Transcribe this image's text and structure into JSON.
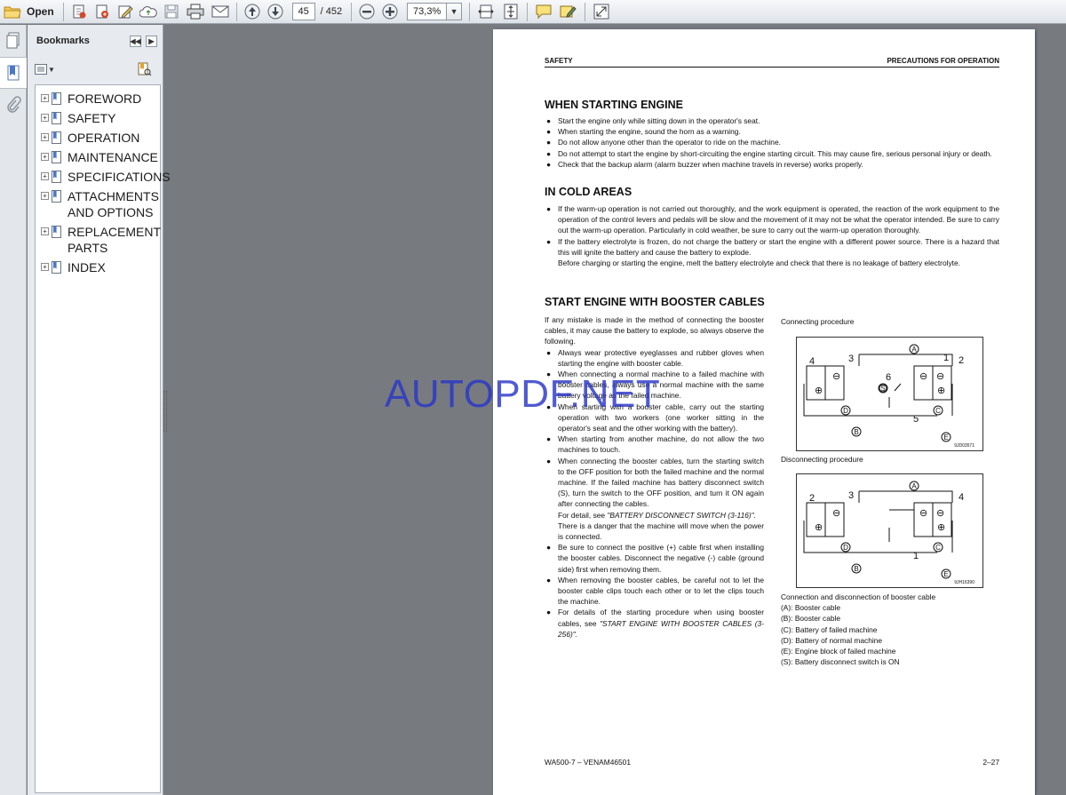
{
  "toolbar": {
    "open_label": "Open",
    "current_page": "45",
    "total_pages": "/ 452",
    "zoom": "73,3%"
  },
  "bookmarks": {
    "title": "Bookmarks",
    "items": [
      {
        "label": "FOREWORD"
      },
      {
        "label": "SAFETY"
      },
      {
        "label": "OPERATION"
      },
      {
        "label": "MAINTENANCE"
      },
      {
        "label": "SPECIFICATIONS"
      },
      {
        "label": "ATTACHMENTS AND OPTIONS"
      },
      {
        "label": "REPLACEMENT PARTS"
      },
      {
        "label": "INDEX"
      }
    ]
  },
  "watermark": "AUTOPDF.NET",
  "document": {
    "header_left": "SAFETY",
    "header_right": "PRECAUTIONS FOR OPERATION",
    "sections": {
      "s1_title": "WHEN STARTING ENGINE",
      "s1_items": [
        "Start the engine only while sitting down in the operator's seat.",
        "When starting the engine, sound the horn as a warning.",
        "Do not allow anyone other than the operator to ride on the machine.",
        "Do not attempt to start the engine by short-circuiting the engine starting circuit. This may cause fire, serious personal injury or death.",
        "Check that the backup alarm (alarm buzzer when machine travels in reverse) works properly."
      ],
      "s2_title": "IN COLD AREAS",
      "s2_item1": "If the warm-up operation is not carried out thoroughly, and the work equipment is operated, the reaction of the work equipment to the operation of the control levers and pedals will be slow and the movement of it may not be what the operator intended. Be sure to carry out the warm-up operation. Particularly in cold weather, be sure to carry out the warm-up operation thoroughly.",
      "s2_item2": "If the battery electrolyte is frozen, do not charge the battery or start the engine with a different power source. There is a hazard that this will ignite the battery and cause the battery to explode.",
      "s2_item2_cont": "Before charging or starting the engine, melt the battery electrolyte and check that there is no leakage of battery electrolyte.",
      "s3_title": "START ENGINE WITH BOOSTER CABLES",
      "s3_intro": "If any mistake is made in the method of connecting the booster cables, it may cause the battery to explode, so always observe the following.",
      "s3_b1": "Always wear protective eyeglasses and rubber gloves when starting the engine with booster cable.",
      "s3_b2": "When connecting a normal machine to a failed machine with booster cables, always use a normal machine with the same battery voltage as the failed machine.",
      "s3_b3": "When starting with a booster cable, carry out the starting operation with two workers (one worker sitting in the operator's seat and the other working with the battery).",
      "s3_b4": "When starting from another machine, do not allow the two machines to touch.",
      "s3_b5": "When connecting the booster cables, turn the starting switch to the OFF position for both the failed machine and the normal machine. If the failed machine has battery disconnect switch (S), turn the switch to the OFF position, and turn it ON again after connecting the cables.",
      "s3_b5_ref_pre": "For detail, see ",
      "s3_b5_ref": "\"BATTERY DISCONNECT SWITCH (3-116)\".",
      "s3_b5_cont2": "There is a danger that the machine will move when the power is connected.",
      "s3_b6": "Be sure to connect the positive (+) cable first when installing the booster cables. Disconnect the negative (-) cable (ground side) first when removing them.",
      "s3_b7": "When removing the booster cables, be careful not to let the booster cable clips touch each other or to let the clips touch the machine.",
      "s3_b8_pre": "For details of the starting procedure when using booster cables, see ",
      "s3_b8_ref": "\"START ENGINE WITH BOOSTER CABLES (3-256)\"."
    },
    "figures": {
      "connecting_label": "Connecting procedure",
      "connecting_code": "9JD03571",
      "disconnecting_label": "Disconnecting procedure",
      "disconnecting_code": "9JH16390",
      "caption_title": "Connection and disconnection of booster cable",
      "legend": [
        "(A): Booster cable",
        "(B): Booster cable",
        "(C): Battery of failed machine",
        "(D): Battery of normal machine",
        "(E): Engine block of failed machine",
        "(S): Battery disconnect switch is ON"
      ],
      "conn_nums": [
        "4",
        "3",
        "6",
        "1",
        "2",
        "5"
      ],
      "disc_nums": [
        "2",
        "3",
        "1",
        "4"
      ],
      "letters": [
        "A",
        "B",
        "C",
        "D",
        "E",
        "S"
      ]
    },
    "footer_left": "WA500-7 – VENAM46501",
    "footer_right": "2–27"
  }
}
